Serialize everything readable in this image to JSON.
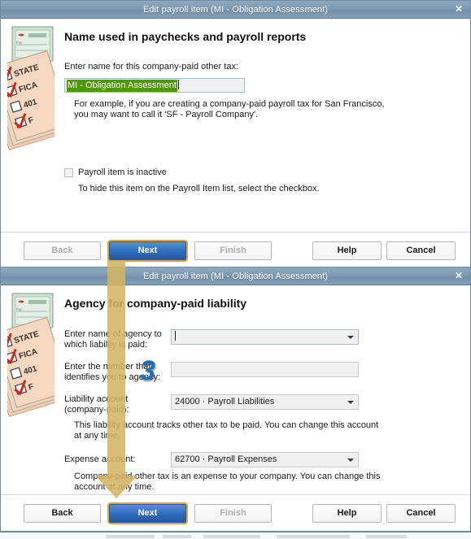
{
  "dialog1": {
    "title": "Edit payroll item (MI - Obligation Assessment)",
    "close_label": "✕",
    "heading": "Name used in paychecks and payroll reports",
    "name_label": "Enter name for this company-paid other tax:",
    "name_value": "MI - Obligation Assessment",
    "example_line1": "For example, if you are creating a company-paid payroll tax for San Francisco,",
    "example_line2": "you may want to call it 'SF - Payroll Company'.",
    "inactive_label": "Payroll item is inactive",
    "inactive_hint": "To hide this item on the Payroll Item list, select the checkbox.",
    "buttons": {
      "back": "Back",
      "next": "Next",
      "finish": "Finish",
      "help": "Help",
      "cancel": "Cancel"
    }
  },
  "dialog2": {
    "title": "Edit payroll item (MI - Obligation Assessment)",
    "close_label": "✕",
    "heading": "Agency for company-paid liability",
    "agency_label_line1": "Enter name of agency to",
    "agency_label_line2": "which liability is paid:",
    "agency_value": "",
    "agency_number_label_line1": "Enter the number that",
    "agency_number_label_line2": "identifies you to agency:",
    "agency_number_value": "",
    "liability_label_line1": "Liability account",
    "liability_label_line2": "(company-paid):",
    "liability_value": "24000 · Payroll Liabilities",
    "liability_hint_line1": "This liability account tracks other tax to be paid. You can change this account",
    "liability_hint_line2": "at any time.",
    "expense_label": "Expense account:",
    "expense_value": "62700 · Payroll Expenses",
    "expense_hint_line1": "Company-paid other tax is an expense to your company. You can change this",
    "expense_hint_line2": "account at any time.",
    "buttons": {
      "back": "Back",
      "next": "Next",
      "finish": "Finish",
      "help": "Help",
      "cancel": "Cancel"
    }
  },
  "illustration": {
    "name": "paycheck-checklist-illustration",
    "check_items": [
      "STATE",
      "FICA",
      "401",
      "F"
    ]
  },
  "annotations": {
    "step_badge": "3",
    "arrow_name": "gold-down-arrow"
  },
  "colors": {
    "titlebar": "#7e9ab2",
    "primary_button": "#2f6ec0",
    "focus_ring": "#d3aa3d",
    "selection_green": "#4e9a06",
    "annotation_gold": "#d3b464",
    "badge_blue": "#1f6fb5"
  }
}
